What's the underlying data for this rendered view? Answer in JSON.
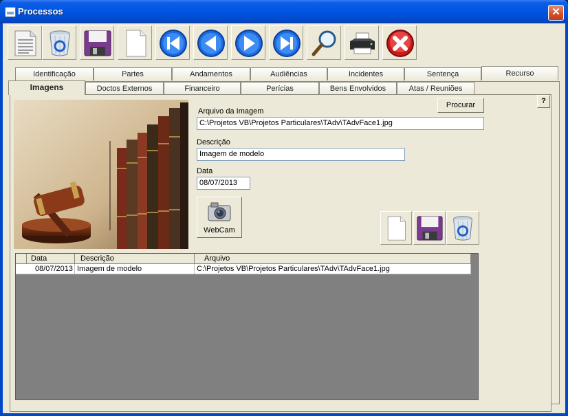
{
  "window": {
    "title": "Processos",
    "close_glyph": "✕"
  },
  "toolbar": {
    "buttons": [
      {
        "name": "list-report-button",
        "icon": "document-list-icon"
      },
      {
        "name": "delete-button",
        "icon": "recycle-bin-icon"
      },
      {
        "name": "save-button",
        "icon": "floppy-disk-icon"
      },
      {
        "name": "new-button",
        "icon": "blank-page-icon"
      },
      {
        "name": "first-record-button",
        "icon": "first-arrow-icon"
      },
      {
        "name": "previous-record-button",
        "icon": "left-arrow-icon"
      },
      {
        "name": "next-record-button",
        "icon": "right-arrow-icon"
      },
      {
        "name": "last-record-button",
        "icon": "last-arrow-icon"
      },
      {
        "name": "search-button",
        "icon": "magnifier-icon"
      },
      {
        "name": "print-button",
        "icon": "printer-icon"
      },
      {
        "name": "exit-button",
        "icon": "red-x-icon"
      }
    ]
  },
  "tabs": {
    "row1": [
      "Identificação",
      "Partes",
      "Andamentos",
      "Audiências",
      "Incidentes",
      "Sentença",
      "Recurso"
    ],
    "row2": [
      "Imagens",
      "Doctos Externos",
      "Financeiro",
      "Perícias",
      "Bens Envolvidos",
      "Atas / Reuniões"
    ],
    "active": "Imagens"
  },
  "form": {
    "help_label": "?",
    "browse_label": "Procurar",
    "file_label": "Arquivo da Imagem",
    "file_value": "C:\\Projetos VB\\Projetos Particulares\\TAdv\\TAdvFace1.jpg",
    "description_label": "Descrição",
    "description_value": "Imagem de modelo",
    "date_label": "Data",
    "date_value": "08/07/2013",
    "webcam_label": "WebCam"
  },
  "grid": {
    "columns": [
      "Data",
      "Descrição",
      "Arquivo"
    ],
    "rows": [
      {
        "date": "08/07/2013",
        "description": "Imagem de modelo",
        "file": "C:\\Projetos VB\\Projetos Particulares\\TAdv\\TAdvFace1.jpg"
      }
    ]
  },
  "colors": {
    "title_bar": "#0055e0",
    "window_bg": "#ece9d8",
    "grid_bg": "#808080"
  }
}
